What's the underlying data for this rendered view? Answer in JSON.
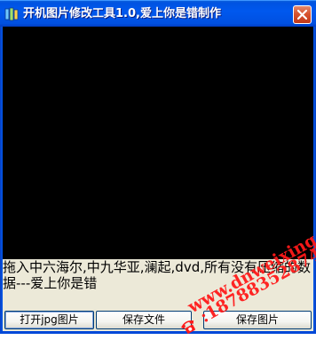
{
  "window": {
    "title": "开机图片修改工具1.0,爱上你是错制作"
  },
  "info_text": "拖入中六海尔,中九华亚,澜起,dvd,所有没有压缩的数据---爱上你是错",
  "buttons": {
    "open_jpg": "打开jpg图片",
    "save_file": "保存文件",
    "save_image": "保存图片"
  },
  "watermark": {
    "url": "www.dnweixing.com",
    "phone": ":18788352874"
  },
  "colors": {
    "titlebar": "#0054e3",
    "preview_bg": "#000000",
    "watermark": "#ff1a1a",
    "window_bg": "#ece9d8"
  }
}
